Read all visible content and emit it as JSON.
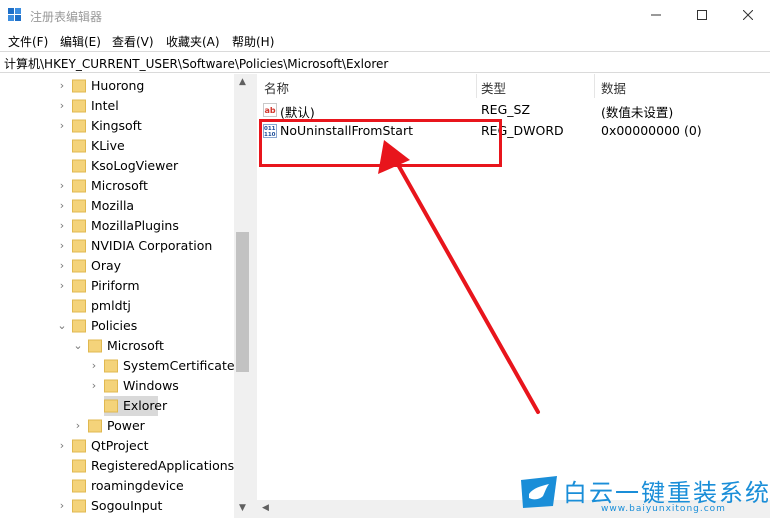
{
  "window": {
    "title": "注册表编辑器",
    "controls": {
      "minimize": "minimize-icon",
      "maximize": "maximize-icon",
      "close": "close-icon"
    }
  },
  "menu": [
    "文件(F)",
    "编辑(E)",
    "查看(V)",
    "收藏夹(A)",
    "帮助(H)"
  ],
  "address": "计算机\\HKEY_CURRENT_USER\\Software\\Policies\\Microsoft\\Exlorer",
  "tree": [
    {
      "label": "Huorong",
      "expander": "›"
    },
    {
      "label": "Intel",
      "expander": "›"
    },
    {
      "label": "Kingsoft",
      "expander": "›"
    },
    {
      "label": "KLive",
      "expander": ""
    },
    {
      "label": "KsoLogViewer",
      "expander": ""
    },
    {
      "label": "Microsoft",
      "expander": "›"
    },
    {
      "label": "Mozilla",
      "expander": "›"
    },
    {
      "label": "MozillaPlugins",
      "expander": "›"
    },
    {
      "label": "NVIDIA Corporation",
      "expander": "›"
    },
    {
      "label": "Oray",
      "expander": "›"
    },
    {
      "label": "Piriform",
      "expander": "›"
    },
    {
      "label": "pmldtj",
      "expander": ""
    },
    {
      "label": "Policies",
      "expander": "⌄"
    },
    {
      "label": "Microsoft",
      "expander": "⌄"
    },
    {
      "label": "SystemCertificates",
      "expander": "›"
    },
    {
      "label": "Windows",
      "expander": "›"
    },
    {
      "label": "Exlorer",
      "expander": "",
      "selected": true
    },
    {
      "label": "Power",
      "expander": "›"
    },
    {
      "label": "QtProject",
      "expander": "›"
    },
    {
      "label": "RegisteredApplications",
      "expander": ""
    },
    {
      "label": "roamingdevice",
      "expander": ""
    },
    {
      "label": "SogouInput",
      "expander": "›"
    }
  ],
  "columns": {
    "name": "名称",
    "type": "类型",
    "data": "数据"
  },
  "values": [
    {
      "name": "(默认)",
      "type": "REG_SZ",
      "data": "(数值未设置)",
      "icon": "string-value-icon"
    },
    {
      "name": "NoUninstallFromStart",
      "type": "REG_DWORD",
      "data": "0x00000000 (0)",
      "icon": "dword-value-icon"
    }
  ],
  "watermark": {
    "title": "白云一键重装系统",
    "url": "www.baiyunxitong.com"
  },
  "colors": {
    "highlight": "#e8151c",
    "folder": "#f4d37a",
    "brand": "#1a8ed8"
  }
}
